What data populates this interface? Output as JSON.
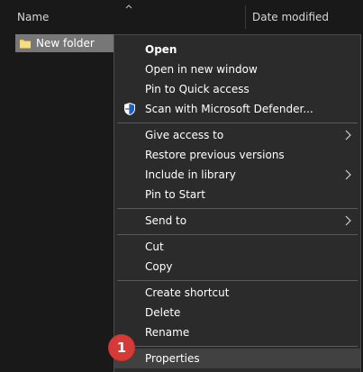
{
  "header": {
    "name_label": "Name",
    "date_label": "Date modified"
  },
  "files": [
    {
      "name": "New folder"
    }
  ],
  "context_menu": {
    "items": [
      {
        "label": "Open"
      },
      {
        "label": "Open in new window"
      },
      {
        "label": "Pin to Quick access"
      },
      {
        "label": "Scan with Microsoft Defender..."
      },
      {
        "label": "Give access to"
      },
      {
        "label": "Restore previous versions"
      },
      {
        "label": "Include in library"
      },
      {
        "label": "Pin to Start"
      },
      {
        "label": "Send to"
      },
      {
        "label": "Cut"
      },
      {
        "label": "Copy"
      },
      {
        "label": "Create shortcut"
      },
      {
        "label": "Delete"
      },
      {
        "label": "Rename"
      },
      {
        "label": "Properties"
      }
    ]
  },
  "annotation": {
    "step": "1",
    "color": "#d63a36"
  },
  "icons": {
    "sort": "chevron-up-icon",
    "folder": "folder-icon",
    "defender": "shield-icon",
    "submenu": "chevron-right-icon"
  },
  "colors": {
    "background": "#191919",
    "menu_background": "#2b2b2b",
    "selection": "#777777",
    "hover": "#414141",
    "folder": "#f1cf5b"
  }
}
